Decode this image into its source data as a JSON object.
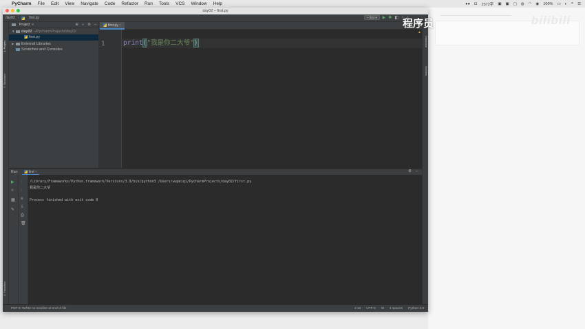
{
  "menubar": {
    "apple": "",
    "app": "PyCharm",
    "items": [
      "File",
      "Edit",
      "View",
      "Navigate",
      "Code",
      "Refactor",
      "Run",
      "Tools",
      "VCS",
      "Window",
      "Help"
    ],
    "chars": "2372字",
    "battery": "100%"
  },
  "watermark": "程序员",
  "brand": "bilibili",
  "window": {
    "title": "day02 – first.py",
    "breadcrumb_project": "day02",
    "breadcrumb_file": "first.py",
    "run_config": "first"
  },
  "sidebar": {
    "project_tab": "1: Project",
    "structure_tab": "7: Structure",
    "favorites_tab": "2: Favorites",
    "database_tab": "Database",
    "sciview_tab": "SciView"
  },
  "project": {
    "header": "Project",
    "root_name": "day02",
    "root_path": "~/PycharmProjects/day02",
    "file": "first.py",
    "external": "External Libraries",
    "scratches": "Scratches and Consoles"
  },
  "editor": {
    "tab": "first.py",
    "line_number": "1",
    "code_fn": "print",
    "code_open": "(",
    "code_str": "\"我是你二大爷\"",
    "code_close": ")"
  },
  "run": {
    "label": "Run:",
    "tab": "first",
    "cmd": "/Library/Frameworks/Python.framework/Versions/3.9/bin/python3 /Users/wupeiqi/PycharmProjects/day02/first.py",
    "output": "我是你二大爷",
    "exit": "Process finished with exit code 0"
  },
  "bottom_tabs": {
    "todo": "6: TODO",
    "run": "4: Run",
    "terminal": "Terminal",
    "console": "Python Console",
    "event_log": "Event Log"
  },
  "status": {
    "message": "PEP 8: W292 no newline at end of file",
    "position": "1:16",
    "encoding": "UTF-8",
    "indent": "4 spaces",
    "interpreter": "Python 3.9"
  }
}
